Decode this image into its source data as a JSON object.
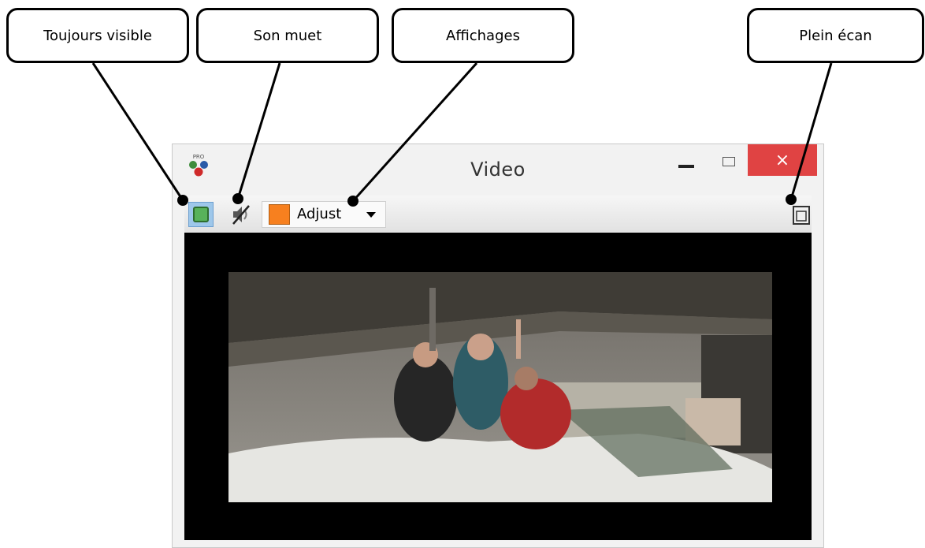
{
  "callouts": {
    "always_on_top": "Toujours visible",
    "mute": "Son muet",
    "displays": "Affichages",
    "fullscreen": "Plein écan"
  },
  "window": {
    "title": "Video",
    "logo_text": "PRO",
    "close_glyph": "×"
  },
  "toolbar": {
    "display_mode_label": "Adjust",
    "display_mode_swatch_color": "#f7801f"
  },
  "icons": {
    "always_on_top": "always-on-top-icon",
    "mute": "mute-icon",
    "fullscreen": "fullscreen-icon"
  },
  "colors": {
    "close_button": "#e04343",
    "toggle_active": "#9ec7ea",
    "video_background": "#000000"
  }
}
